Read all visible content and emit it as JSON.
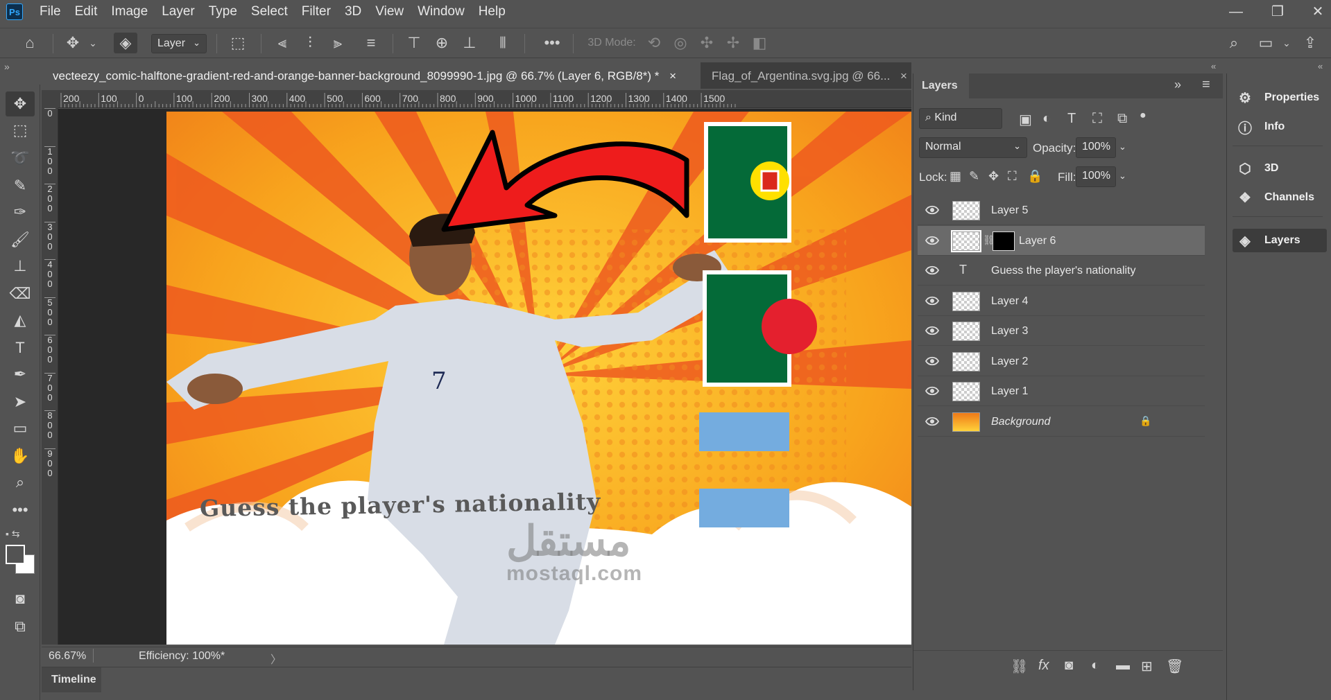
{
  "app": {
    "logo": "Ps"
  },
  "menu": [
    "File",
    "Edit",
    "Image",
    "Layer",
    "Type",
    "Select",
    "Filter",
    "3D",
    "View",
    "Window",
    "Help"
  ],
  "options": {
    "auto_select": "Layer",
    "mode_label": "3D Mode:"
  },
  "tabs": [
    {
      "title": "vecteezy_comic-halftone-gradient-red-and-orange-banner-background_8099990-1.jpg @ 66.7% (Layer 6, RGB/8*) *",
      "close": "×"
    },
    {
      "title": "Flag_of_Argentina.svg.jpg @ 66...",
      "close": "×"
    }
  ],
  "ruler_h": [
    "200",
    "100",
    "0",
    "100",
    "200",
    "300",
    "400",
    "500",
    "600",
    "700",
    "800",
    "900",
    "1000",
    "1100",
    "1200",
    "1300",
    "1400",
    "1500"
  ],
  "ruler_v": [
    "0",
    "1\n0\n0",
    "2\n0\n0",
    "3\n0\n0",
    "4\n0\n0",
    "5\n0\n0",
    "6\n0\n0",
    "7\n0\n0",
    "8\n0\n0",
    "9\n0\n0"
  ],
  "canvas": {
    "headline": "Guess the player's nationality",
    "watermark_ar": "مستقل",
    "watermark_en": "mostaql.com"
  },
  "status": {
    "zoom": "66.67%",
    "efficiency": "Efficiency: 100%*",
    "arrow": "〉"
  },
  "timeline": {
    "label": "Timeline"
  },
  "layers_panel": {
    "title": "Layers",
    "filter_kind": "Kind",
    "blend_mode": "Normal",
    "opacity_label": "Opacity:",
    "opacity": "100%",
    "lock_label": "Lock:",
    "fill_label": "Fill:",
    "fill": "100%",
    "layers": [
      {
        "name": "Layer 5",
        "kind": "pixel",
        "selected": false
      },
      {
        "name": "Layer 6",
        "kind": "masked",
        "selected": true
      },
      {
        "name": "Guess the player's nationality",
        "kind": "text",
        "selected": false
      },
      {
        "name": "Layer 4",
        "kind": "pixel",
        "selected": false
      },
      {
        "name": "Layer 3",
        "kind": "pixel",
        "selected": false
      },
      {
        "name": "Layer 2",
        "kind": "pixel",
        "selected": false
      },
      {
        "name": "Layer 1",
        "kind": "pixel",
        "selected": false
      },
      {
        "name": "Background",
        "kind": "background",
        "selected": false
      }
    ]
  },
  "dock": [
    {
      "label": "Properties",
      "icon": "properties-icon"
    },
    {
      "label": "Info",
      "icon": "info-icon"
    },
    {
      "label": "3D",
      "icon": "cube-icon"
    },
    {
      "label": "Channels",
      "icon": "channels-icon"
    },
    {
      "label": "Layers",
      "icon": "layers-icon"
    }
  ],
  "colors": {
    "accent_selected": "#6a6a6a",
    "panel": "#535353",
    "flag_green": "#046a38",
    "flag_blue": "#74acdf"
  }
}
